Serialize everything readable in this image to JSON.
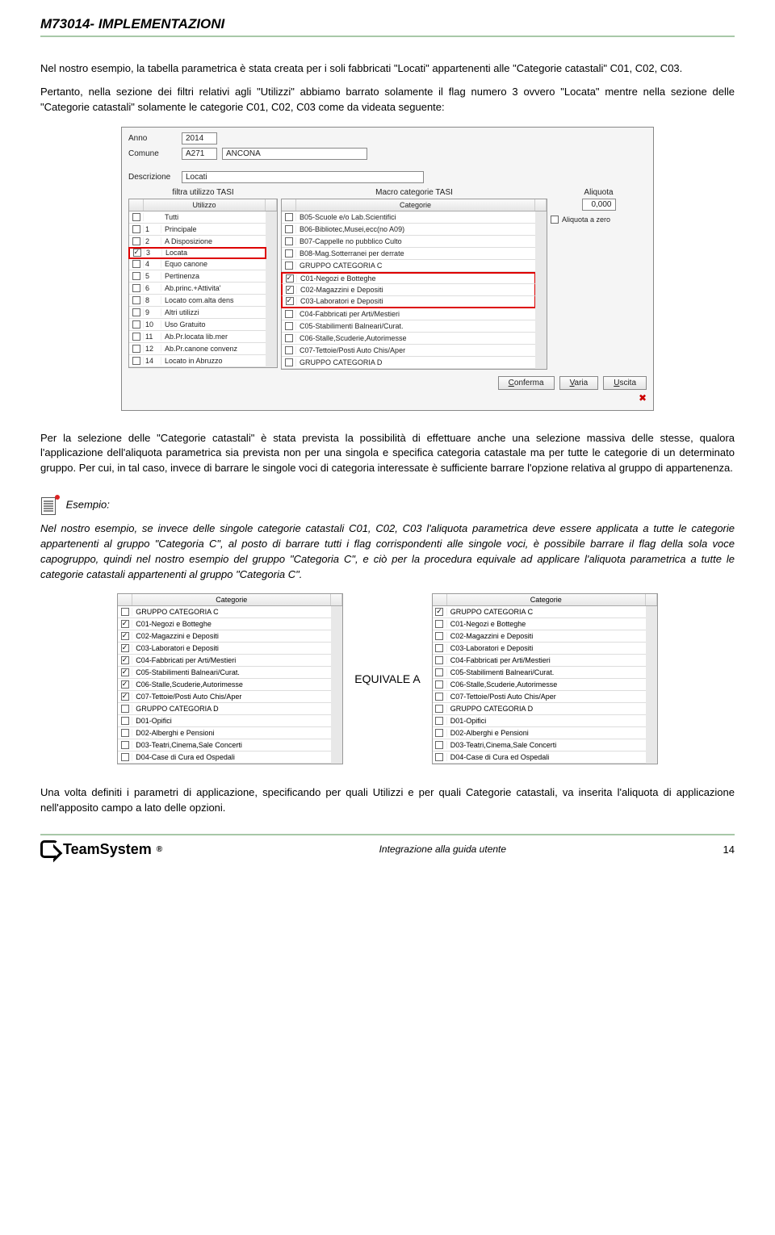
{
  "header": {
    "title": "M73014- IMPLEMENTAZIONI"
  },
  "para1": "Nel nostro esempio, la tabella parametrica è stata creata per i soli fabbricati \"Locati\" appartenenti alle \"Categorie catastali\" C01, C02, C03.",
  "para2": "Pertanto, nella sezione dei filtri relativi agli \"Utilizzi\" abbiamo barrato solamente il flag numero 3 ovvero \"Locata\" mentre nella sezione delle \"Categorie catastali\" solamente le categorie C01, C02, C03 come da videata seguente:",
  "ui": {
    "anno_lbl": "Anno",
    "anno_val": "2014",
    "comune_lbl": "Comune",
    "comune_code": "A271",
    "comune_name": "ANCONA",
    "descrizione_lbl": "Descrizione",
    "descrizione_val": "Locati",
    "col_left_title": "filtra utilizzo TASI",
    "col_mid_title": "Macro categorie TASI",
    "col_right_title": "Aliquota",
    "utilizzo_hd": "Utilizzo",
    "categorie_hd": "Categorie",
    "aliquota_val": "0,000",
    "aliquota_zero_lbl": "Aliquota a zero",
    "utilizzi": [
      {
        "c": "",
        "t": "Tutti",
        "on": false
      },
      {
        "c": "1",
        "t": "Principale",
        "on": false
      },
      {
        "c": "2",
        "t": "A Disposizione",
        "on": false
      },
      {
        "c": "3",
        "t": "Locata",
        "on": true
      },
      {
        "c": "4",
        "t": "Equo canone",
        "on": false
      },
      {
        "c": "5",
        "t": "Pertinenza",
        "on": false
      },
      {
        "c": "6",
        "t": "Ab.princ.+Attivita'",
        "on": false
      },
      {
        "c": "8",
        "t": "Locato com.alta dens",
        "on": false
      },
      {
        "c": "9",
        "t": "Altri utilizzi",
        "on": false
      },
      {
        "c": "10",
        "t": "Uso Gratuito",
        "on": false
      },
      {
        "c": "11",
        "t": "Ab.Pr.locata lib.mer",
        "on": false
      },
      {
        "c": "12",
        "t": "Ab.Pr.canone convenz",
        "on": false
      },
      {
        "c": "14",
        "t": "Locato in Abruzzo",
        "on": false
      }
    ],
    "categorie": [
      {
        "t": "B05-Scuole e/o Lab.Scientifici",
        "on": false
      },
      {
        "t": "B06-Bibliotec,Musei,ecc(no A09)",
        "on": false
      },
      {
        "t": "B07-Cappelle no pubblico Culto",
        "on": false
      },
      {
        "t": "B08-Mag.Sotterranei per derrate",
        "on": false
      },
      {
        "t": "GRUPPO CATEGORIA C",
        "on": false
      },
      {
        "t": "C01-Negozi e Botteghe",
        "on": true
      },
      {
        "t": "C02-Magazzini e Depositi",
        "on": true
      },
      {
        "t": "C03-Laboratori e Depositi",
        "on": true
      },
      {
        "t": "C04-Fabbricati per Arti/Mestieri",
        "on": false
      },
      {
        "t": "C05-Stabilimenti Balneari/Curat.",
        "on": false
      },
      {
        "t": "C06-Stalle,Scuderie,Autorimesse",
        "on": false
      },
      {
        "t": "C07-Tettoie/Posti Auto Chis/Aper",
        "on": false
      },
      {
        "t": "GRUPPO CATEGORIA D",
        "on": false
      }
    ],
    "btn_conferma": "Conferma",
    "btn_varia": "Varia",
    "btn_uscita": "Uscita"
  },
  "para3": "Per la selezione delle \"Categorie catastali\" è stata prevista la possibilità di effettuare anche una selezione massiva delle stesse, qualora l'applicazione dell'aliquota parametrica sia prevista non per una singola e specifica categoria catastale ma per tutte le categorie di un determinato gruppo. Per cui, in tal caso, invece di barrare le singole voci di categoria interessate è sufficiente barrare l'opzione relativa al gruppo di appartenenza.",
  "example_label": "Esempio:",
  "para4": "Nel nostro esempio, se invece delle singole categorie catastali C01, C02, C03 l'aliquota parametrica deve essere applicata a tutte le categorie appartenenti al gruppo \"Categoria C\", al posto di barrare tutti i flag corrispondenti alle singole voci, è possibile barrare il flag della sola voce capogruppo, quindi nel nostro esempio del gruppo \"Categoria C\", e ciò per la procedura equivale ad applicare l'aliquota parametrica a tutte le categorie catastali appartenenti al gruppo \"Categoria C\".",
  "compare": {
    "equiv": "EQUIVALE A",
    "hd": "Categorie",
    "left": [
      {
        "t": "GRUPPO CATEGORIA C",
        "on": false
      },
      {
        "t": "C01-Negozi e Botteghe",
        "on": true
      },
      {
        "t": "C02-Magazzini e Depositi",
        "on": true
      },
      {
        "t": "C03-Laboratori e Depositi",
        "on": true
      },
      {
        "t": "C04-Fabbricati per Arti/Mestieri",
        "on": true
      },
      {
        "t": "C05-Stabilimenti Balneari/Curat.",
        "on": true
      },
      {
        "t": "C06-Stalle,Scuderie,Autorimesse",
        "on": true
      },
      {
        "t": "C07-Tettoie/Posti Auto Chis/Aper",
        "on": true
      },
      {
        "t": "GRUPPO CATEGORIA D",
        "on": false
      },
      {
        "t": "D01-Opifici",
        "on": false
      },
      {
        "t": "D02-Alberghi e Pensioni",
        "on": false
      },
      {
        "t": "D03-Teatri,Cinema,Sale Concerti",
        "on": false
      },
      {
        "t": "D04-Case di Cura ed Ospedali",
        "on": false
      }
    ],
    "right": [
      {
        "t": "GRUPPO CATEGORIA C",
        "on": true
      },
      {
        "t": "C01-Negozi e Botteghe",
        "on": false
      },
      {
        "t": "C02-Magazzini e Depositi",
        "on": false
      },
      {
        "t": "C03-Laboratori e Depositi",
        "on": false
      },
      {
        "t": "C04-Fabbricati per Arti/Mestieri",
        "on": false
      },
      {
        "t": "C05-Stabilimenti Balneari/Curat.",
        "on": false
      },
      {
        "t": "C06-Stalle,Scuderie,Autorimesse",
        "on": false
      },
      {
        "t": "C07-Tettoie/Posti Auto Chis/Aper",
        "on": false
      },
      {
        "t": "GRUPPO CATEGORIA D",
        "on": false
      },
      {
        "t": "D01-Opifici",
        "on": false
      },
      {
        "t": "D02-Alberghi e Pensioni",
        "on": false
      },
      {
        "t": "D03-Teatri,Cinema,Sale Concerti",
        "on": false
      },
      {
        "t": "D04-Case di Cura ed Ospedali",
        "on": false
      }
    ]
  },
  "para5": "Una volta definiti i parametri di applicazione, specificando per quali Utilizzi e per quali Categorie catastali, va inserita l'aliquota di applicazione nell'apposito campo a lato delle opzioni.",
  "footer": {
    "logo": "TeamSystem",
    "mid": "Integrazione alla guida utente",
    "page": "14"
  }
}
